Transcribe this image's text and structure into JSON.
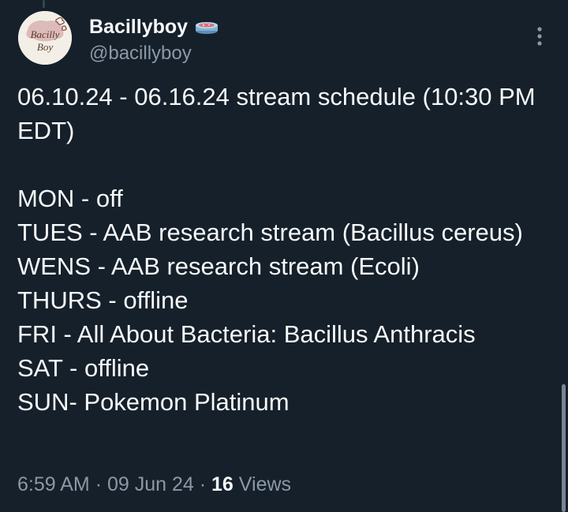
{
  "tweet": {
    "author": {
      "display_name": "Bacillyboy",
      "handle": "@bacillyboy",
      "avatar_text": "Bacilly Boy",
      "badge_icon": "petri-dish-icon"
    },
    "text": "06.10.24 - 06.16.24 stream schedule (10:30 PM EDT)\n\nMON - off\nTUES - AAB research stream (Bacillus cereus)\nWENS - AAB research stream (Ecoli)\nTHURS - offline\nFRI - All About Bacteria: Bacillus Anthracis\nSAT - offline\nSUN- Pokemon Platinum",
    "timestamp_time": "6:59 AM",
    "separator": "·",
    "timestamp_date": "09 Jun 24",
    "views_count": "16",
    "views_label": "Views"
  },
  "colors": {
    "background": "#15202b",
    "primary_text": "#f7f9f9",
    "secondary_text": "#8b98a5"
  }
}
